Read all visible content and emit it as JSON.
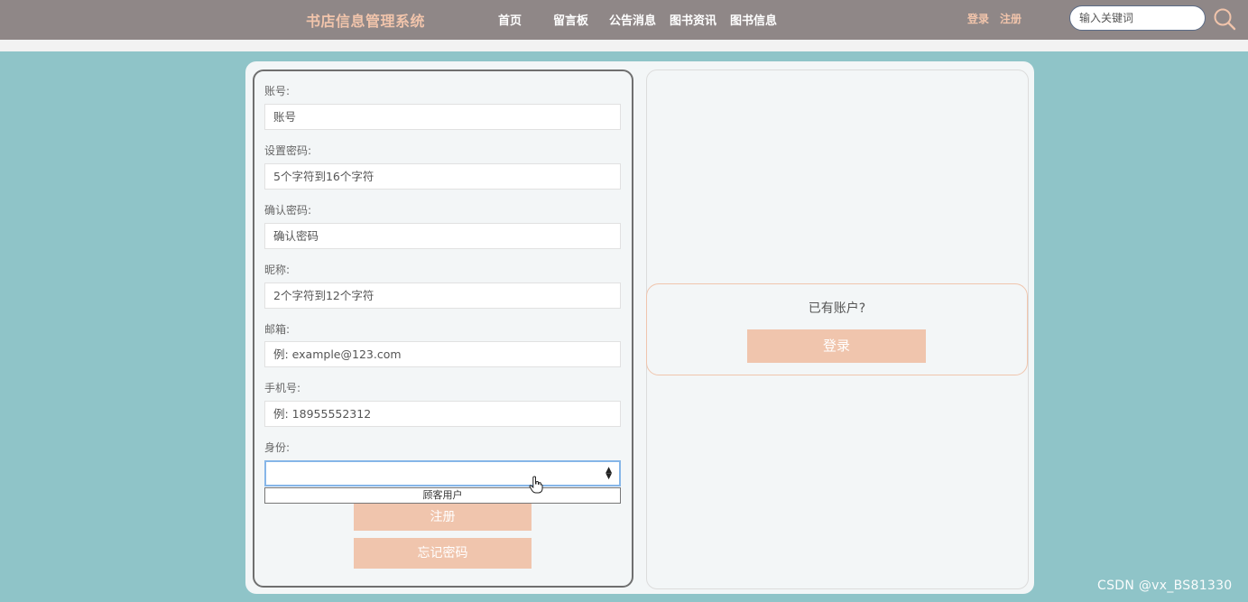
{
  "header": {
    "site_title": "书店信息管理系统",
    "nav": [
      {
        "label": "首页"
      },
      {
        "label": "留言板"
      },
      {
        "label": "公告消息"
      },
      {
        "label": "图书资讯"
      },
      {
        "label": "图书信息"
      }
    ],
    "login_label": "登录",
    "register_label": "注册",
    "search_placeholder": "输入关键词",
    "search_icon": "search-icon"
  },
  "form": {
    "account": {
      "label": "账号:",
      "placeholder": "账号",
      "value": ""
    },
    "password": {
      "label": "设置密码:",
      "placeholder": "5个字符到16个字符",
      "value": ""
    },
    "confirm_password": {
      "label": "确认密码:",
      "placeholder": "确认密码",
      "value": ""
    },
    "nickname": {
      "label": "昵称:",
      "placeholder": "2个字符到12个字符",
      "value": ""
    },
    "email": {
      "label": "邮箱:",
      "placeholder": "例: example@123.com",
      "value": ""
    },
    "phone": {
      "label": "手机号:",
      "placeholder": "例: 18955552312",
      "value": ""
    },
    "identity": {
      "label": "身份:",
      "selected": "",
      "options": [
        "顾客用户"
      ]
    },
    "register_button": "注册",
    "forgot_button": "忘记密码"
  },
  "side": {
    "question": "已有账户?",
    "login_button": "登录"
  },
  "watermark": "CSDN @vx_BS81330",
  "colors": {
    "background": "#8fc4c8",
    "header": "#8f8787",
    "accent": "#f0c5ad",
    "title": "#f1c4ab"
  }
}
